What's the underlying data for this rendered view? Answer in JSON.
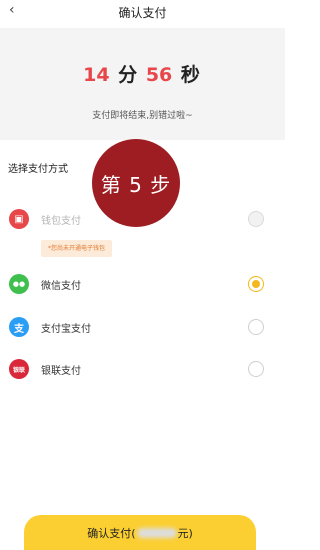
{
  "nav": {
    "back_icon": "‹",
    "title": "确认支付"
  },
  "timer": {
    "minutes": "14",
    "minute_unit": "分",
    "seconds": "56",
    "second_unit": "秒",
    "note": "支付即将结束,别错过啦~"
  },
  "section_label": "选择支付方式",
  "step_badge": "第 5 步",
  "methods": [
    {
      "label": "钱包支付",
      "icon": "wallet-icon",
      "icon_glyph": "▣",
      "color": "#e8474a",
      "state": "disabled"
    },
    {
      "label": "微信支付",
      "icon": "wechat-icon",
      "icon_glyph": "●●",
      "color": "#3fbf4e",
      "state": "checked"
    },
    {
      "label": "支付宝支付",
      "icon": "alipay-icon",
      "icon_glyph": "支",
      "color": "#2a9df4",
      "state": "unchecked"
    },
    {
      "label": "银联支付",
      "icon": "unionpay-icon",
      "icon_glyph": "银联",
      "color": "#d8283a",
      "state": "unchecked"
    }
  ],
  "wallet_note": "*您尚未开通电子钱包",
  "confirm": {
    "prefix": "确认支付(",
    "suffix": "元)"
  },
  "colors": {
    "accent": "#fbcf32",
    "countdown": "#e8474a",
    "badge": "#9e1d22"
  }
}
